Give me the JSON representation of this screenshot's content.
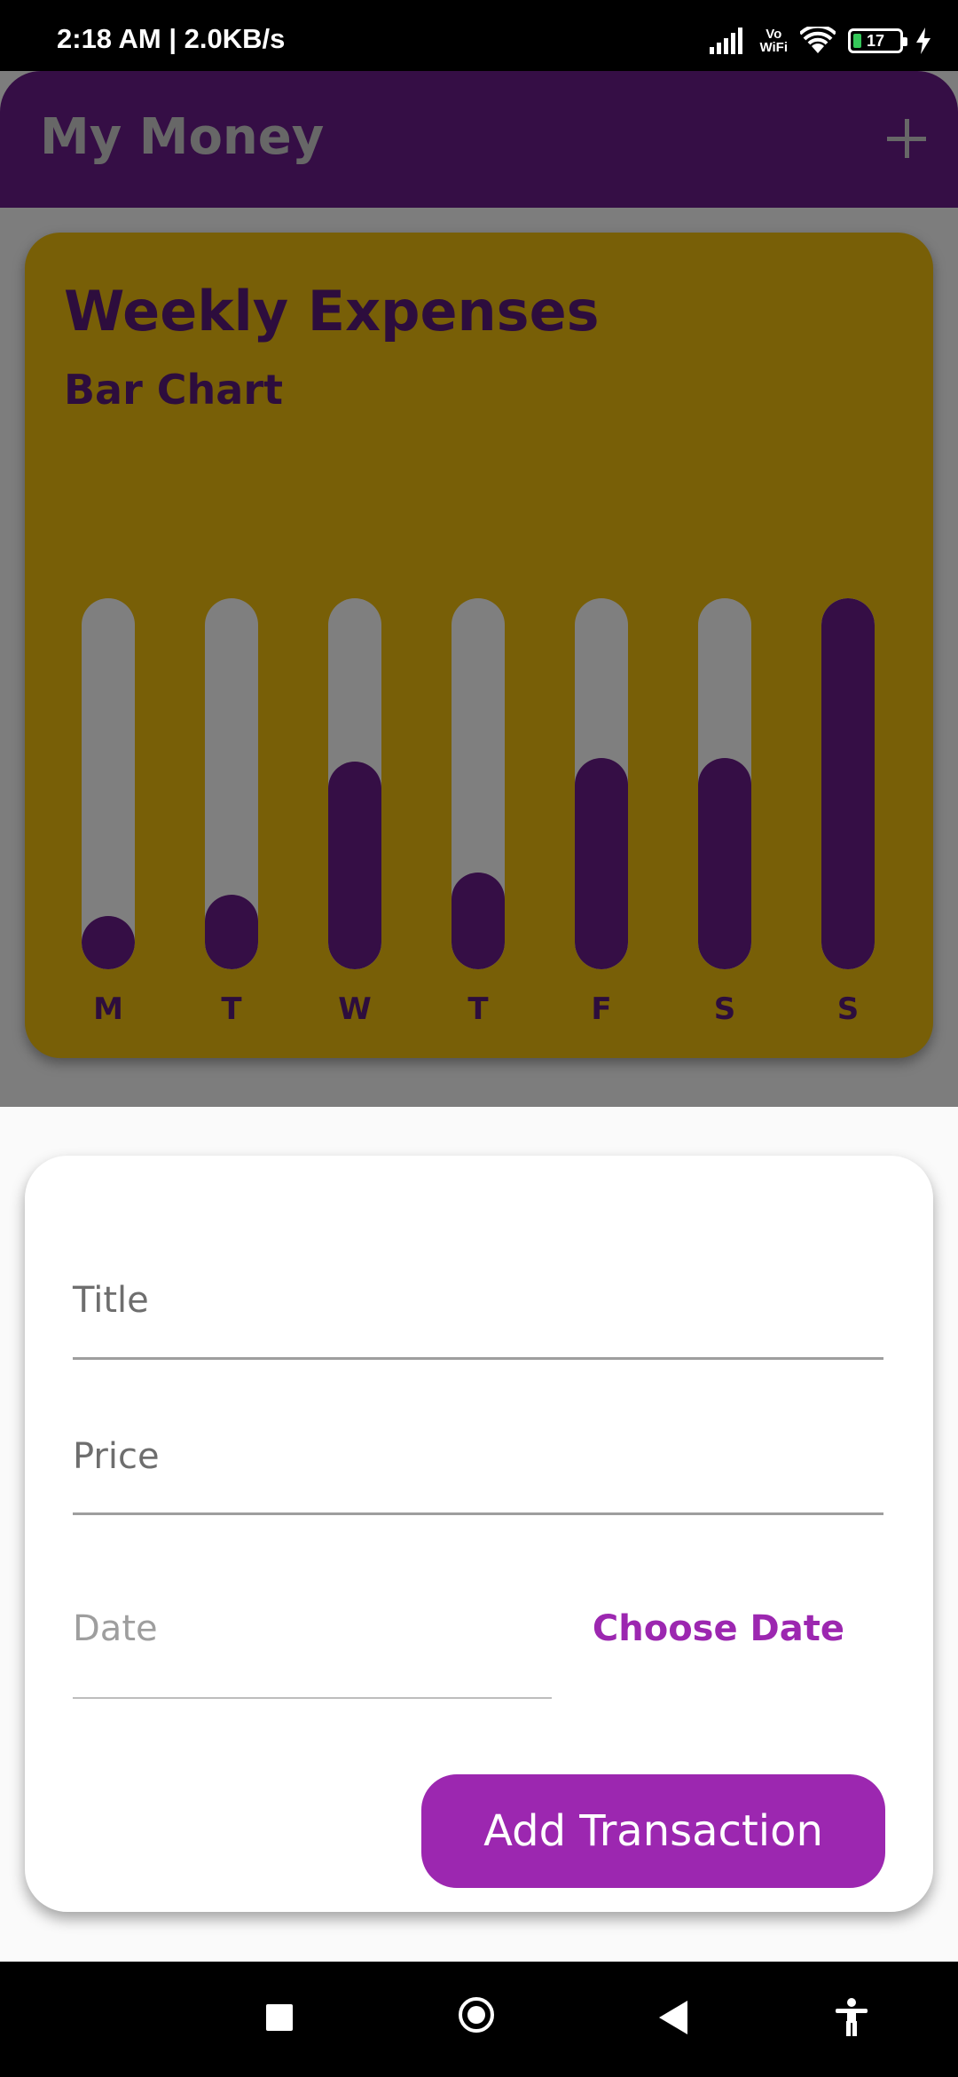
{
  "status_bar": {
    "time": "2:18 AM | 2.0KB/s",
    "vowifi_top": "Vo",
    "vowifi_bottom": "WiFi",
    "battery": "17",
    "battery_level": 0.17
  },
  "app_bar": {
    "title": "My Money",
    "add_icon": "plus-icon"
  },
  "chart_card": {
    "title": "Weekly Expenses",
    "subtitle": "Bar Chart"
  },
  "chart_data": {
    "type": "bar",
    "title": "Weekly Expenses",
    "subtitle": "Bar Chart",
    "categories": [
      "M",
      "T",
      "W",
      "T",
      "F",
      "S",
      "S"
    ],
    "values": [
      0.14,
      0.2,
      0.56,
      0.26,
      0.57,
      0.57,
      1.0
    ],
    "ylim": [
      0,
      1
    ],
    "colors": {
      "fill": "#6b1d8a",
      "track": "#ffffff",
      "card": "#f1bf0f"
    }
  },
  "form": {
    "title_placeholder": "Title",
    "price_placeholder": "Price",
    "date_placeholder": "Date",
    "choose_date": "Choose Date",
    "submit": "Add Transaction"
  },
  "nav_bar": {
    "icons": [
      "recents-icon",
      "home-icon",
      "back-icon",
      "accessibility-icon"
    ]
  },
  "colors": {
    "primary": "#9c27b0",
    "app_bar": "#6b1d8a",
    "accent": "#f1bf0f"
  }
}
